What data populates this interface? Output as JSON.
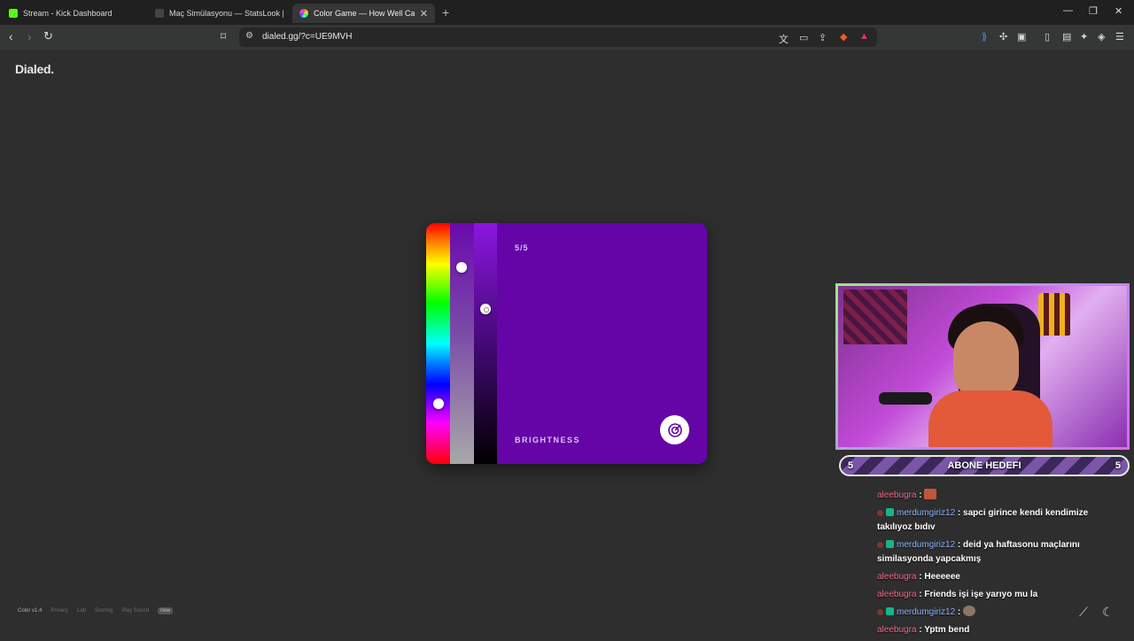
{
  "browser": {
    "tabs": [
      {
        "title": "Stream - Kick Dashboard",
        "favicon_color": "#53fc18",
        "favicon_text": "K"
      },
      {
        "title": "Maç Simülasyonu — StatsLook | Stats",
        "favicon_color": "#222222",
        "favicon_text": "sl"
      },
      {
        "title": "Color Game — How Well Can Yo",
        "favicon_color": "#c060ff",
        "favicon_text": ""
      }
    ],
    "new_tab": "+",
    "window_controls": {
      "minimize": "—",
      "restore": "❐",
      "close": "✕"
    },
    "url": "dialed.gg/?c=UE9MVH"
  },
  "page": {
    "logo": "Dialed.",
    "game": {
      "round": "5/5",
      "stage_label": "BRIGHTNESS",
      "target_color": "#6505a8",
      "hue_level": 0.76,
      "saturation_level": 0.17,
      "brightness_level": 0.35
    },
    "footer": {
      "version": "Color v1.4",
      "links": [
        "Privacy",
        "Lab",
        "Scoring",
        "Play Sound"
      ],
      "badge": "new"
    }
  },
  "stream": {
    "goal": {
      "left": "5",
      "title": "ABONE HEDEFI",
      "right": "5"
    },
    "chat": [
      {
        "user": "aleebugra",
        "color": "pink",
        "badge": false,
        "text": "",
        "emote": true
      },
      {
        "user": "merdumgiriz12",
        "color": "blue",
        "badge": true,
        "text": "sapci girince kendi kendimize takılıyoz bıdıv",
        "emote": false
      },
      {
        "user": "merdumgiriz12",
        "color": "blue",
        "badge": true,
        "text": "deid ya haftasonu maçlarını similasyonda yapcakmış",
        "emote": false
      },
      {
        "user": "aleebugra",
        "color": "pink",
        "badge": false,
        "text": "Heeeeee",
        "emote": false
      },
      {
        "user": "aleebugra",
        "color": "pink",
        "badge": false,
        "text": "Friends işi işe yarıyo mu la",
        "emote": false
      },
      {
        "user": "merdumgiriz12",
        "color": "blue",
        "badge": true,
        "text": "",
        "emote": true
      },
      {
        "user": "aleebugra",
        "color": "pink",
        "badge": false,
        "text": "Yptm bend",
        "emote": false
      }
    ]
  }
}
